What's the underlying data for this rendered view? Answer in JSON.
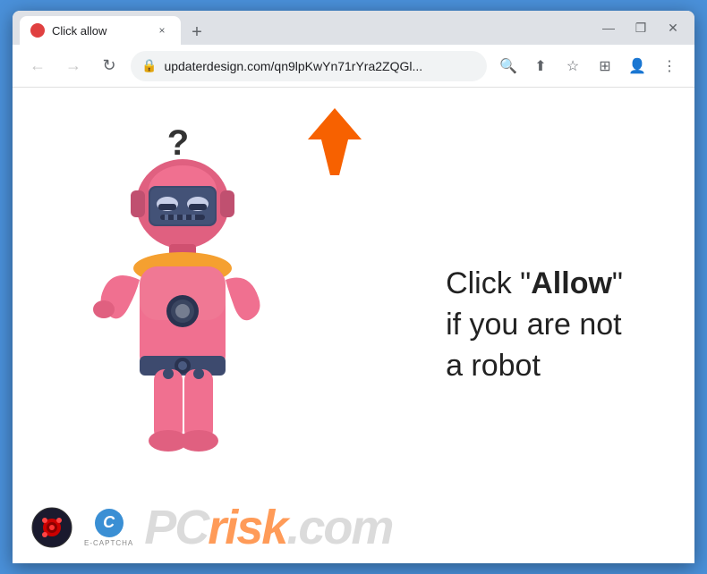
{
  "window": {
    "title": "Click allow",
    "tab_close": "×",
    "new_tab": "+",
    "controls": {
      "minimize": "—",
      "maximize": "❐",
      "close": "✕"
    }
  },
  "nav": {
    "back": "←",
    "forward": "→",
    "refresh": "↻",
    "url": "updaterdesign.com/qn9lpKwYn71rYra2ZQGl...",
    "search_icon": "🔍",
    "share_icon": "⬆",
    "bookmark_icon": "☆",
    "extensions_icon": "⊞",
    "profile_icon": "👤",
    "menu_icon": "⋮"
  },
  "page": {
    "message_line1": "Click \"",
    "message_bold": "Allow",
    "message_line1_end": "\"",
    "message_line2": "if you are not",
    "message_line3": "a robot"
  },
  "watermark": {
    "pc": "PC",
    "risk": "risk",
    "dot": ".",
    "com": "com",
    "ecaptcha_c": "C",
    "ecaptcha_label": "E-CAPTCHA"
  },
  "colors": {
    "accent": "#ff6600",
    "robot_body": "#f07090",
    "robot_head": "#e06080",
    "robot_visor": "#3d4a6e",
    "robot_belt": "#3d4a6e",
    "chrome_bg": "#dee1e6",
    "tab_bg": "#ffffff"
  }
}
